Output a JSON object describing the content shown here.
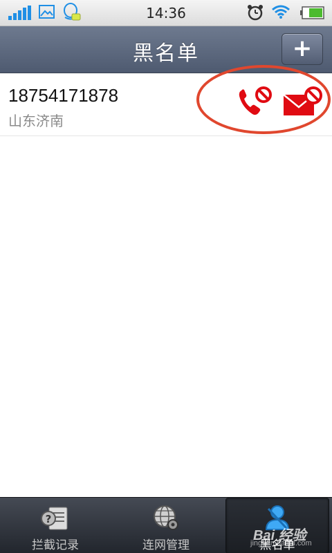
{
  "status_bar": {
    "time": "14:36",
    "icons": [
      "signal-icon",
      "gallery-icon",
      "qq-message-icon",
      "alarm-icon",
      "wifi-icon",
      "battery-icon"
    ]
  },
  "header": {
    "title": "黑名单",
    "add_label": "+"
  },
  "blacklist": [
    {
      "number": "18754171878",
      "location": "山东济南",
      "block_calls": true,
      "block_sms": true
    }
  ],
  "tabs": [
    {
      "label": "拦截记录",
      "icon": "intercept-log-icon",
      "active": false
    },
    {
      "label": "连网管理",
      "icon": "network-settings-icon",
      "active": false
    },
    {
      "label": "黑名单",
      "icon": "blacklist-icon",
      "active": true
    }
  ],
  "watermark": {
    "brand": "Bai 经验",
    "domain": "jingyan.baidu.com"
  },
  "colors": {
    "accent_red": "#e00b12",
    "annotation_red": "#e0472e",
    "header_bg": "#5c6880",
    "status_blue": "#1f8fe5"
  }
}
